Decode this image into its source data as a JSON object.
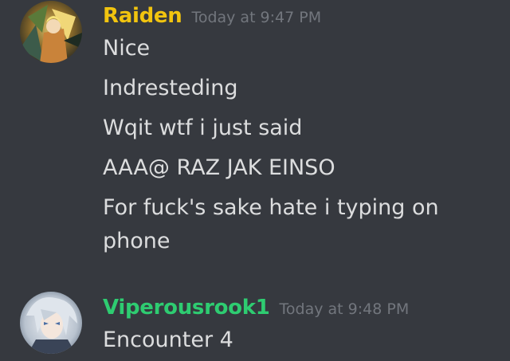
{
  "colors": {
    "background": "#36393f",
    "message_text": "#dcddde",
    "timestamp": "#72767d"
  },
  "messages": [
    {
      "author": "Raiden",
      "author_color": "#f1c40f",
      "timestamp": "Today at 9:47 PM",
      "avatar_icon": "anime-character-avatar-icon",
      "lines": [
        "Nice",
        "Indresteding",
        "Wqit wtf i just said",
        "AAA@ RAZ JAK EINSO",
        "For fuck's sake hate i typing on",
        "phone"
      ]
    },
    {
      "author": "Viperousrook1",
      "author_color": "#2ecc71",
      "timestamp": "Today at 9:48 PM",
      "avatar_icon": "anime-character-avatar-icon",
      "lines": [
        "Encounter 4"
      ]
    }
  ]
}
